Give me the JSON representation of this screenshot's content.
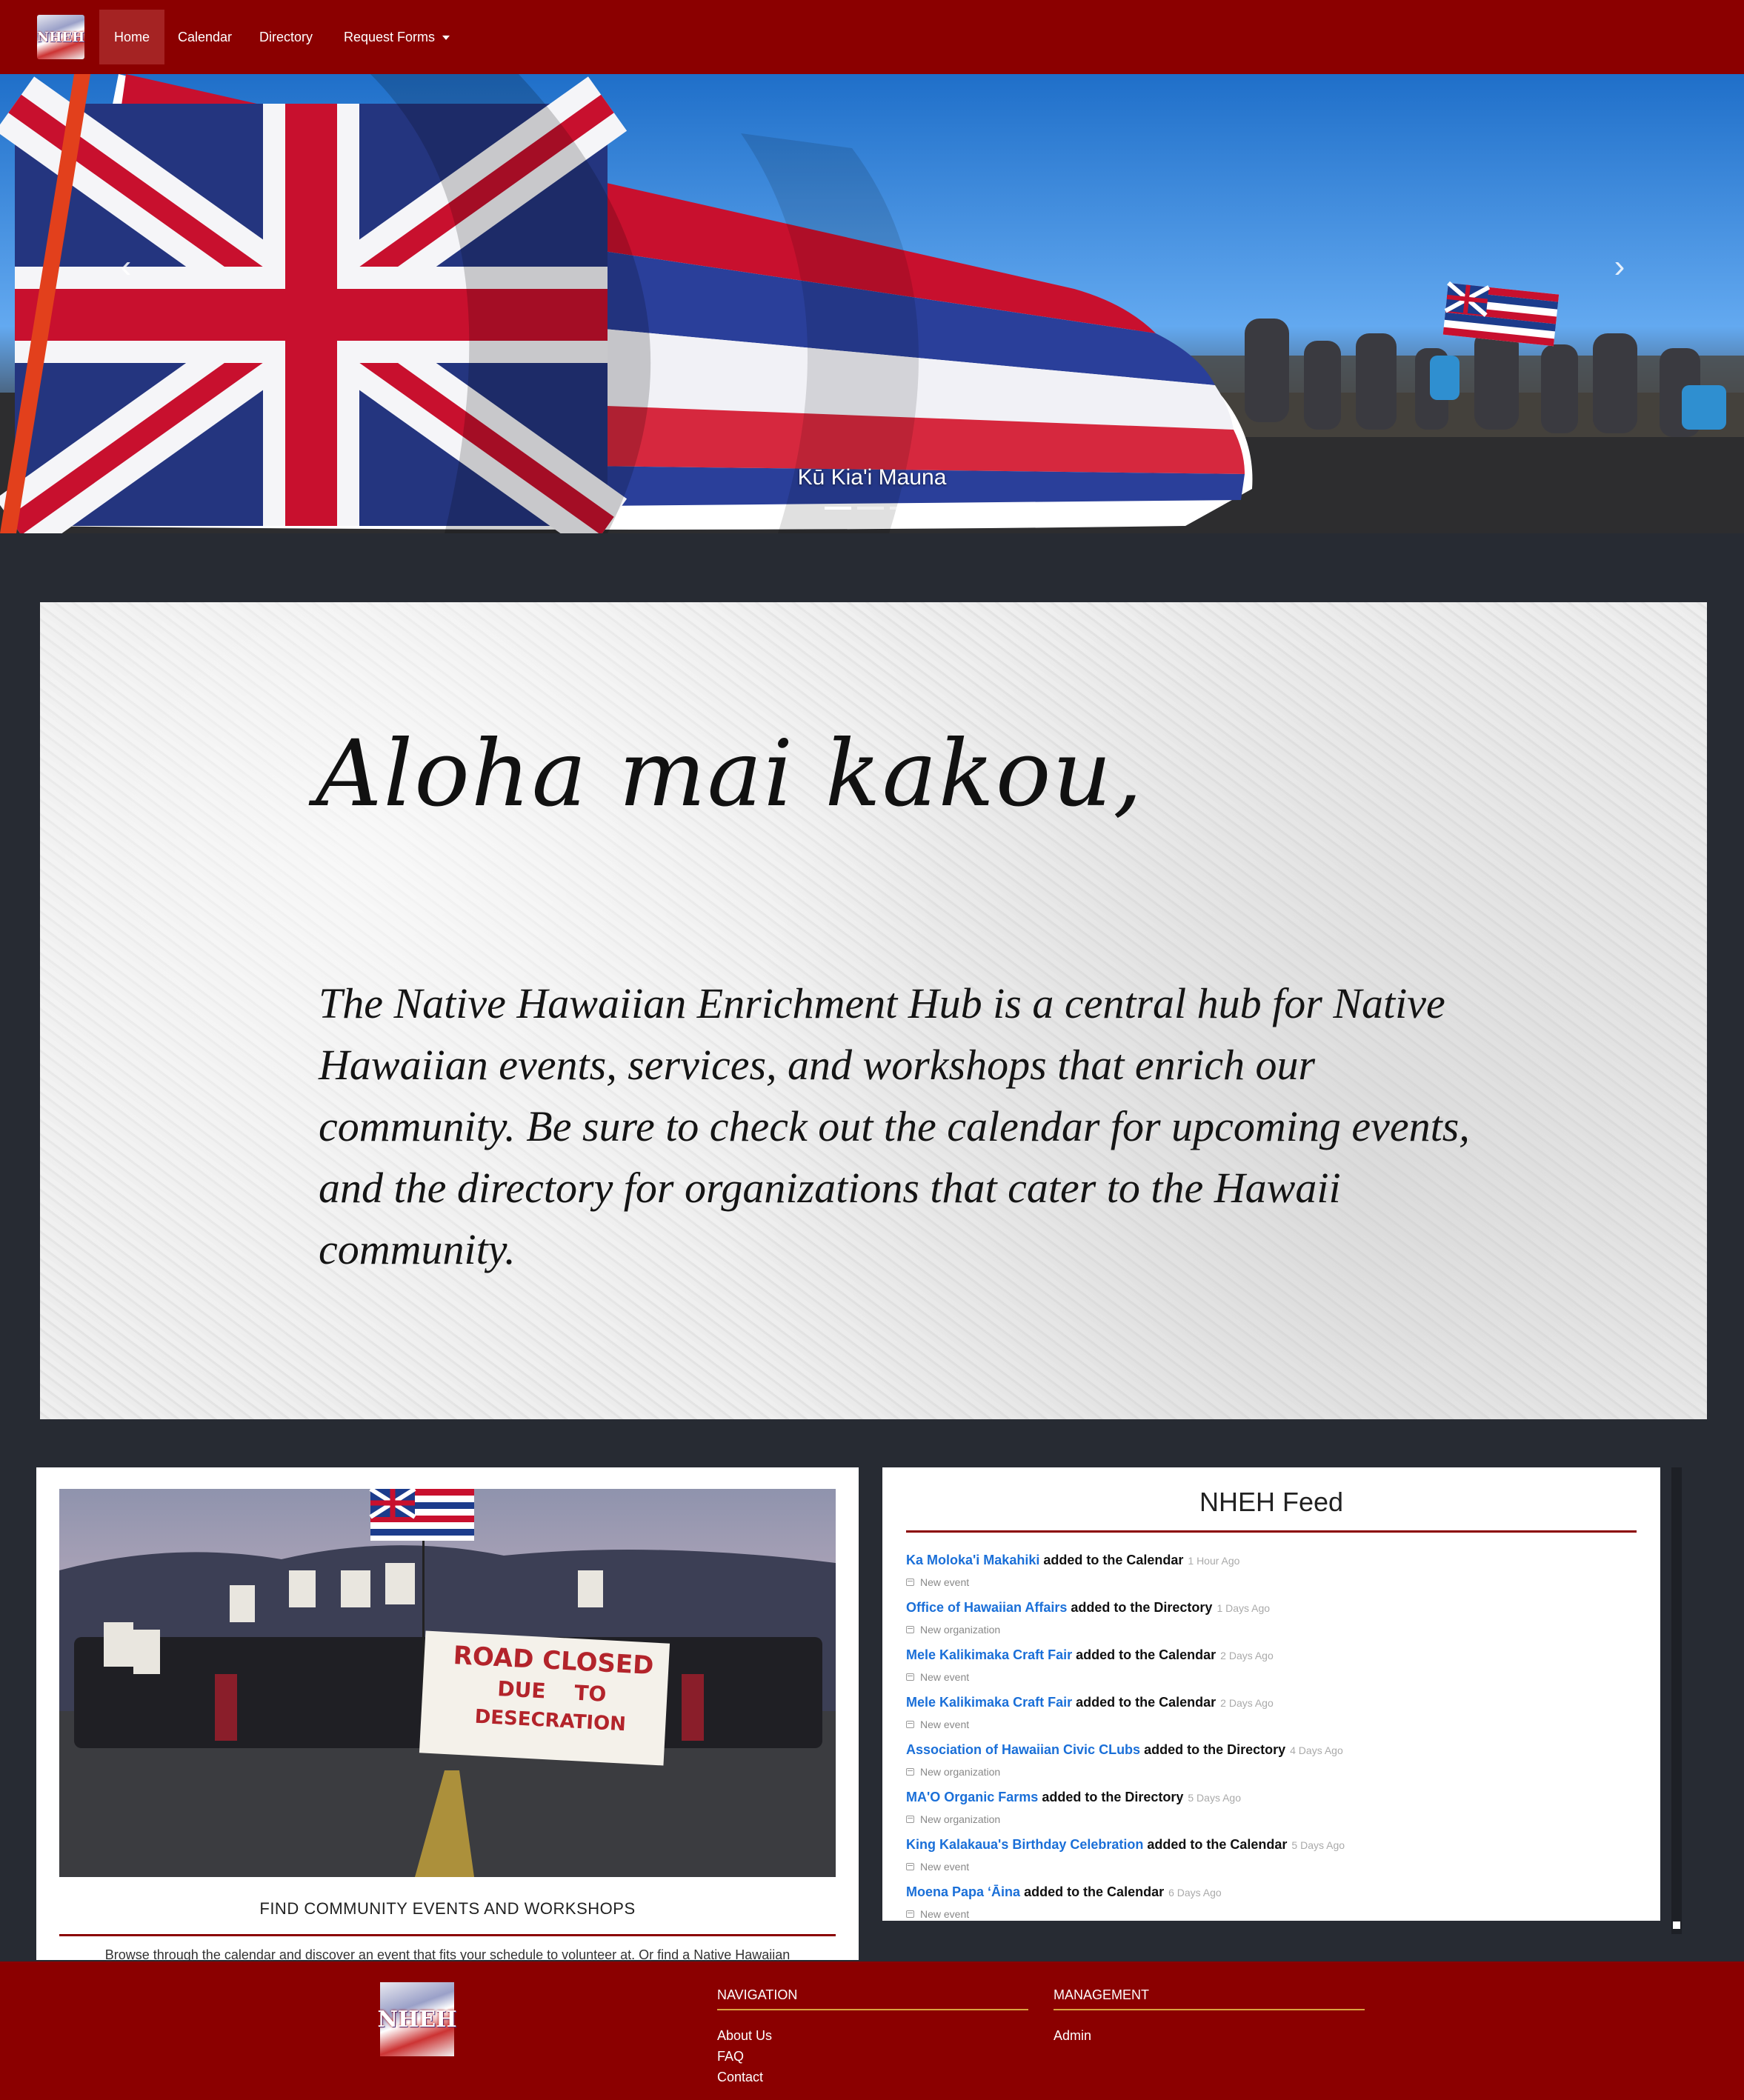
{
  "brand": {
    "logo_text": "NHEH"
  },
  "nav": {
    "items": [
      {
        "label": "Home",
        "active": true
      },
      {
        "label": "Calendar"
      },
      {
        "label": "Directory"
      },
      {
        "label": "Request Forms",
        "dropdown": true
      }
    ]
  },
  "hero": {
    "caption": "Kū Kia'i Mauna",
    "slide_count": 3,
    "active_slide": 1
  },
  "welcome": {
    "greeting": "Aloha mai kakou,",
    "text": "The Native Hawaiian Enrichment Hub is a central hub for Native Hawaiian events, services, and workshops that enrich our community. Be sure to check out the calendar for upcoming events, and the directory for organizations that cater to the Hawaii community."
  },
  "events_card": {
    "photo_sign": [
      "ROAD CLOSED",
      "DUE",
      "TO",
      "DESECRATION"
    ],
    "title": "FIND COMMUNITY EVENTS AND WORKSHOPS",
    "text": "Browse through the calendar and discover an event that fits your schedule to volunteer at. Or find a Native Hawaiian"
  },
  "feed": {
    "title": "NHEH Feed",
    "items": [
      {
        "name": "Ka Moloka'i Makahiki",
        "action": "added to the Calendar",
        "time": "1 Hour Ago",
        "sub": "New event",
        "icon": "calendar-icon"
      },
      {
        "name": "Office of Hawaiian Affairs",
        "action": "added to the Directory",
        "time": "1 Days Ago",
        "sub": "New organization",
        "icon": "directory-icon"
      },
      {
        "name": "Mele Kalikimaka Craft Fair",
        "action": "added to the Calendar",
        "time": "2 Days Ago",
        "sub": "New event",
        "icon": "calendar-icon"
      },
      {
        "name": "Mele Kalikimaka Craft Fair",
        "action": "added to the Calendar",
        "time": "2 Days Ago",
        "sub": "New event",
        "icon": "calendar-icon"
      },
      {
        "name": "Association of Hawaiian Civic CLubs",
        "action": "added to the Directory",
        "time": "4 Days Ago",
        "sub": "New organization",
        "icon": "directory-icon"
      },
      {
        "name": "MA'O Organic Farms",
        "action": "added to the Directory",
        "time": "5 Days Ago",
        "sub": "New organization",
        "icon": "directory-icon"
      },
      {
        "name": "King Kalakaua's Birthday Celebration",
        "action": "added to the Calendar",
        "time": "5 Days Ago",
        "sub": "New event",
        "icon": "calendar-icon"
      },
      {
        "name": "Moena Papa ʻĀina",
        "action": "added to the Calendar",
        "time": "6 Days Ago",
        "sub": "New event",
        "icon": "calendar-icon"
      }
    ]
  },
  "footer": {
    "logo_text": "NHEH",
    "navigation": {
      "heading": "NAVIGATION",
      "links": [
        "About Us",
        "FAQ",
        "Contact"
      ]
    },
    "management": {
      "heading": "MANAGEMENT",
      "links": [
        "Admin"
      ]
    }
  },
  "colors": {
    "brand_red": "#8b0000",
    "link_blue": "#1a6fd8",
    "footer_rule": "#d9a441",
    "page_bg": "#272b33"
  }
}
